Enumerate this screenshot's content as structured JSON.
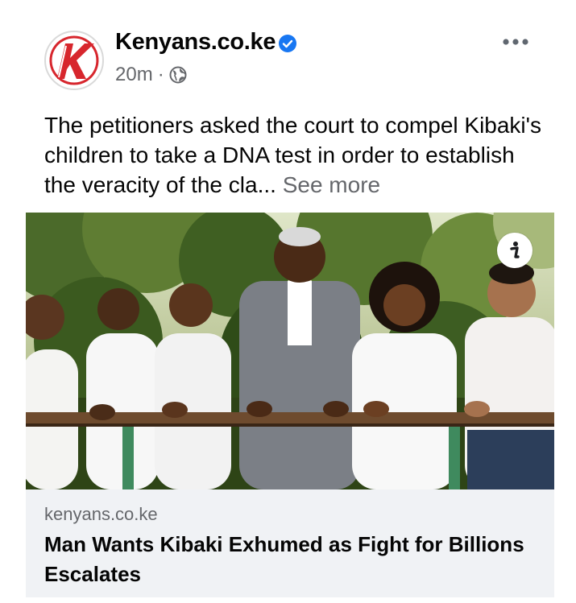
{
  "post": {
    "page_name": "Kenyans.co.ke",
    "time": "20m",
    "separator": "·",
    "caption": "The petitioners asked the court to compel Kibaki's children to take a DNA test in order to establish the veracity of the cla...",
    "see_more": "See more"
  },
  "link": {
    "domain": "kenyans.co.ke",
    "title": "Man Wants Kibaki Exhumed as Fight for Billions Escalates"
  },
  "icons": {
    "avatar": "kenyans-logo-icon",
    "verified": "verified-badge-icon",
    "audience": "globe-icon",
    "more": "more-options-icon",
    "info": "info-icon"
  },
  "colors": {
    "brand_red": "#d7262d",
    "verified_blue": "#1877f2",
    "secondary_text": "#65676b",
    "link_background": "#f0f2f5"
  }
}
